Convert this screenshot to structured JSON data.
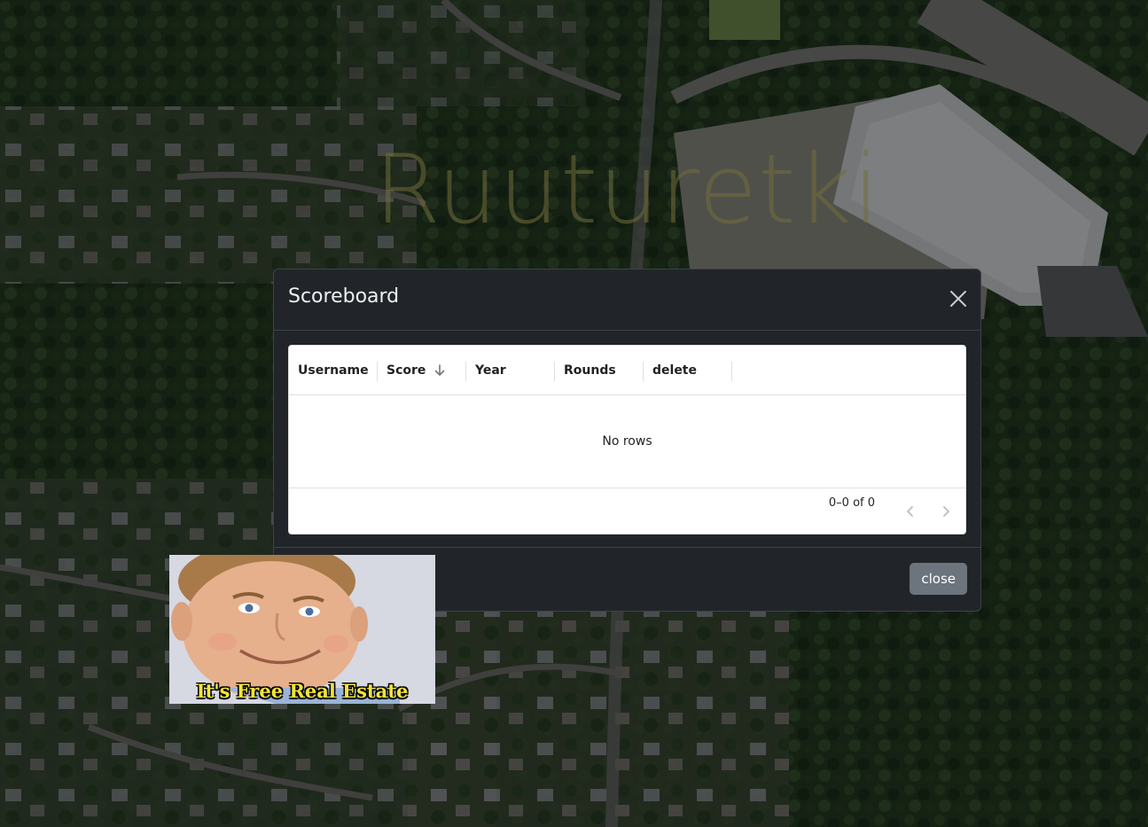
{
  "app": {
    "brand_title": "Ruuturetki"
  },
  "scoreboard": {
    "title": "Scoreboard",
    "columns": [
      {
        "label": "Username"
      },
      {
        "label": "Score",
        "sort": "descending"
      },
      {
        "label": "Year"
      },
      {
        "label": "Rounds"
      },
      {
        "label": "delete"
      }
    ],
    "empty_text": "No rows",
    "pagination": {
      "range_text": "0–0 of 0"
    },
    "close_label": "close"
  },
  "meme": {
    "caption": "It's Free Real Estate"
  },
  "icons": {
    "close": "close-icon",
    "sort": "arrow-down-icon",
    "prev": "chevron-left-icon",
    "next": "chevron-right-icon"
  },
  "colors": {
    "modal_bg": "#212529",
    "close_button": "#6c757d",
    "grid_bg": "#ffffff",
    "caption_yellow": "#f2e33a"
  }
}
